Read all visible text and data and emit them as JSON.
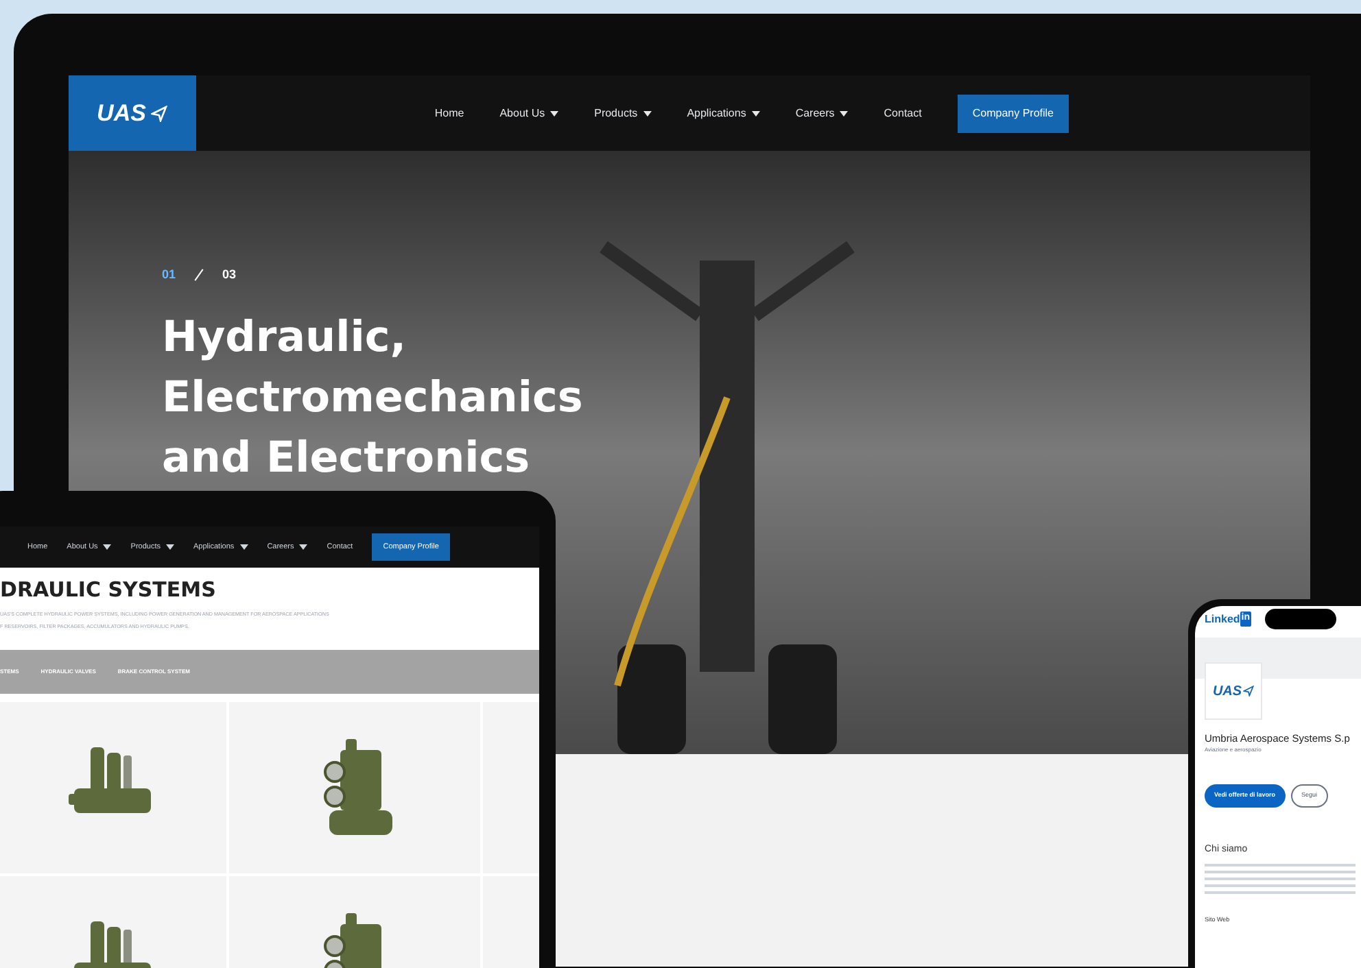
{
  "desktop": {
    "logo": "UAS",
    "nav": [
      {
        "label": "Home",
        "dropdown": false
      },
      {
        "label": "About Us",
        "dropdown": true
      },
      {
        "label": "Products",
        "dropdown": true
      },
      {
        "label": "Applications",
        "dropdown": true
      },
      {
        "label": "Careers",
        "dropdown": true
      },
      {
        "label": "Contact",
        "dropdown": false
      }
    ],
    "cta": "Company Profile",
    "slide_current": "01",
    "slide_total": "03",
    "headline": [
      "Hydraulic,",
      "Electromechanics",
      "and Electronics"
    ]
  },
  "tablet": {
    "nav": [
      {
        "label": "Home",
        "dropdown": false
      },
      {
        "label": "About Us",
        "dropdown": true
      },
      {
        "label": "Products",
        "dropdown": true
      },
      {
        "label": "Applications",
        "dropdown": true
      },
      {
        "label": "Careers",
        "dropdown": true
      },
      {
        "label": "Contact",
        "dropdown": false
      }
    ],
    "cta": "Company Profile",
    "title": "DRAULIC SYSTEMS",
    "description": [
      "UAS'S COMPLETE HYDRAULIC POWER SYSTEMS, INCLUDING POWER GENERATION AND MANAGEMENT FOR AEROSPACE APPLICATIONS",
      "F RESERVOIRS, FILTER PACKAGES, ACCUMULATORS AND HYDRAULIC PUMPS."
    ],
    "tabs": [
      "STEMS",
      "HYDRAULIC VALVES",
      "BRAKE CONTROL SYSTEM"
    ]
  },
  "phone": {
    "brand": "Linked",
    "brand_badge": "in",
    "logo": "UAS",
    "company": "Umbria Aerospace Systems S.p",
    "industry": "Aviazione e aerospazio",
    "primary_button": "Vedi offerte di lavoro",
    "secondary_button": "Segui",
    "about_title": "Chi siamo",
    "website_label": "Sito Web"
  }
}
